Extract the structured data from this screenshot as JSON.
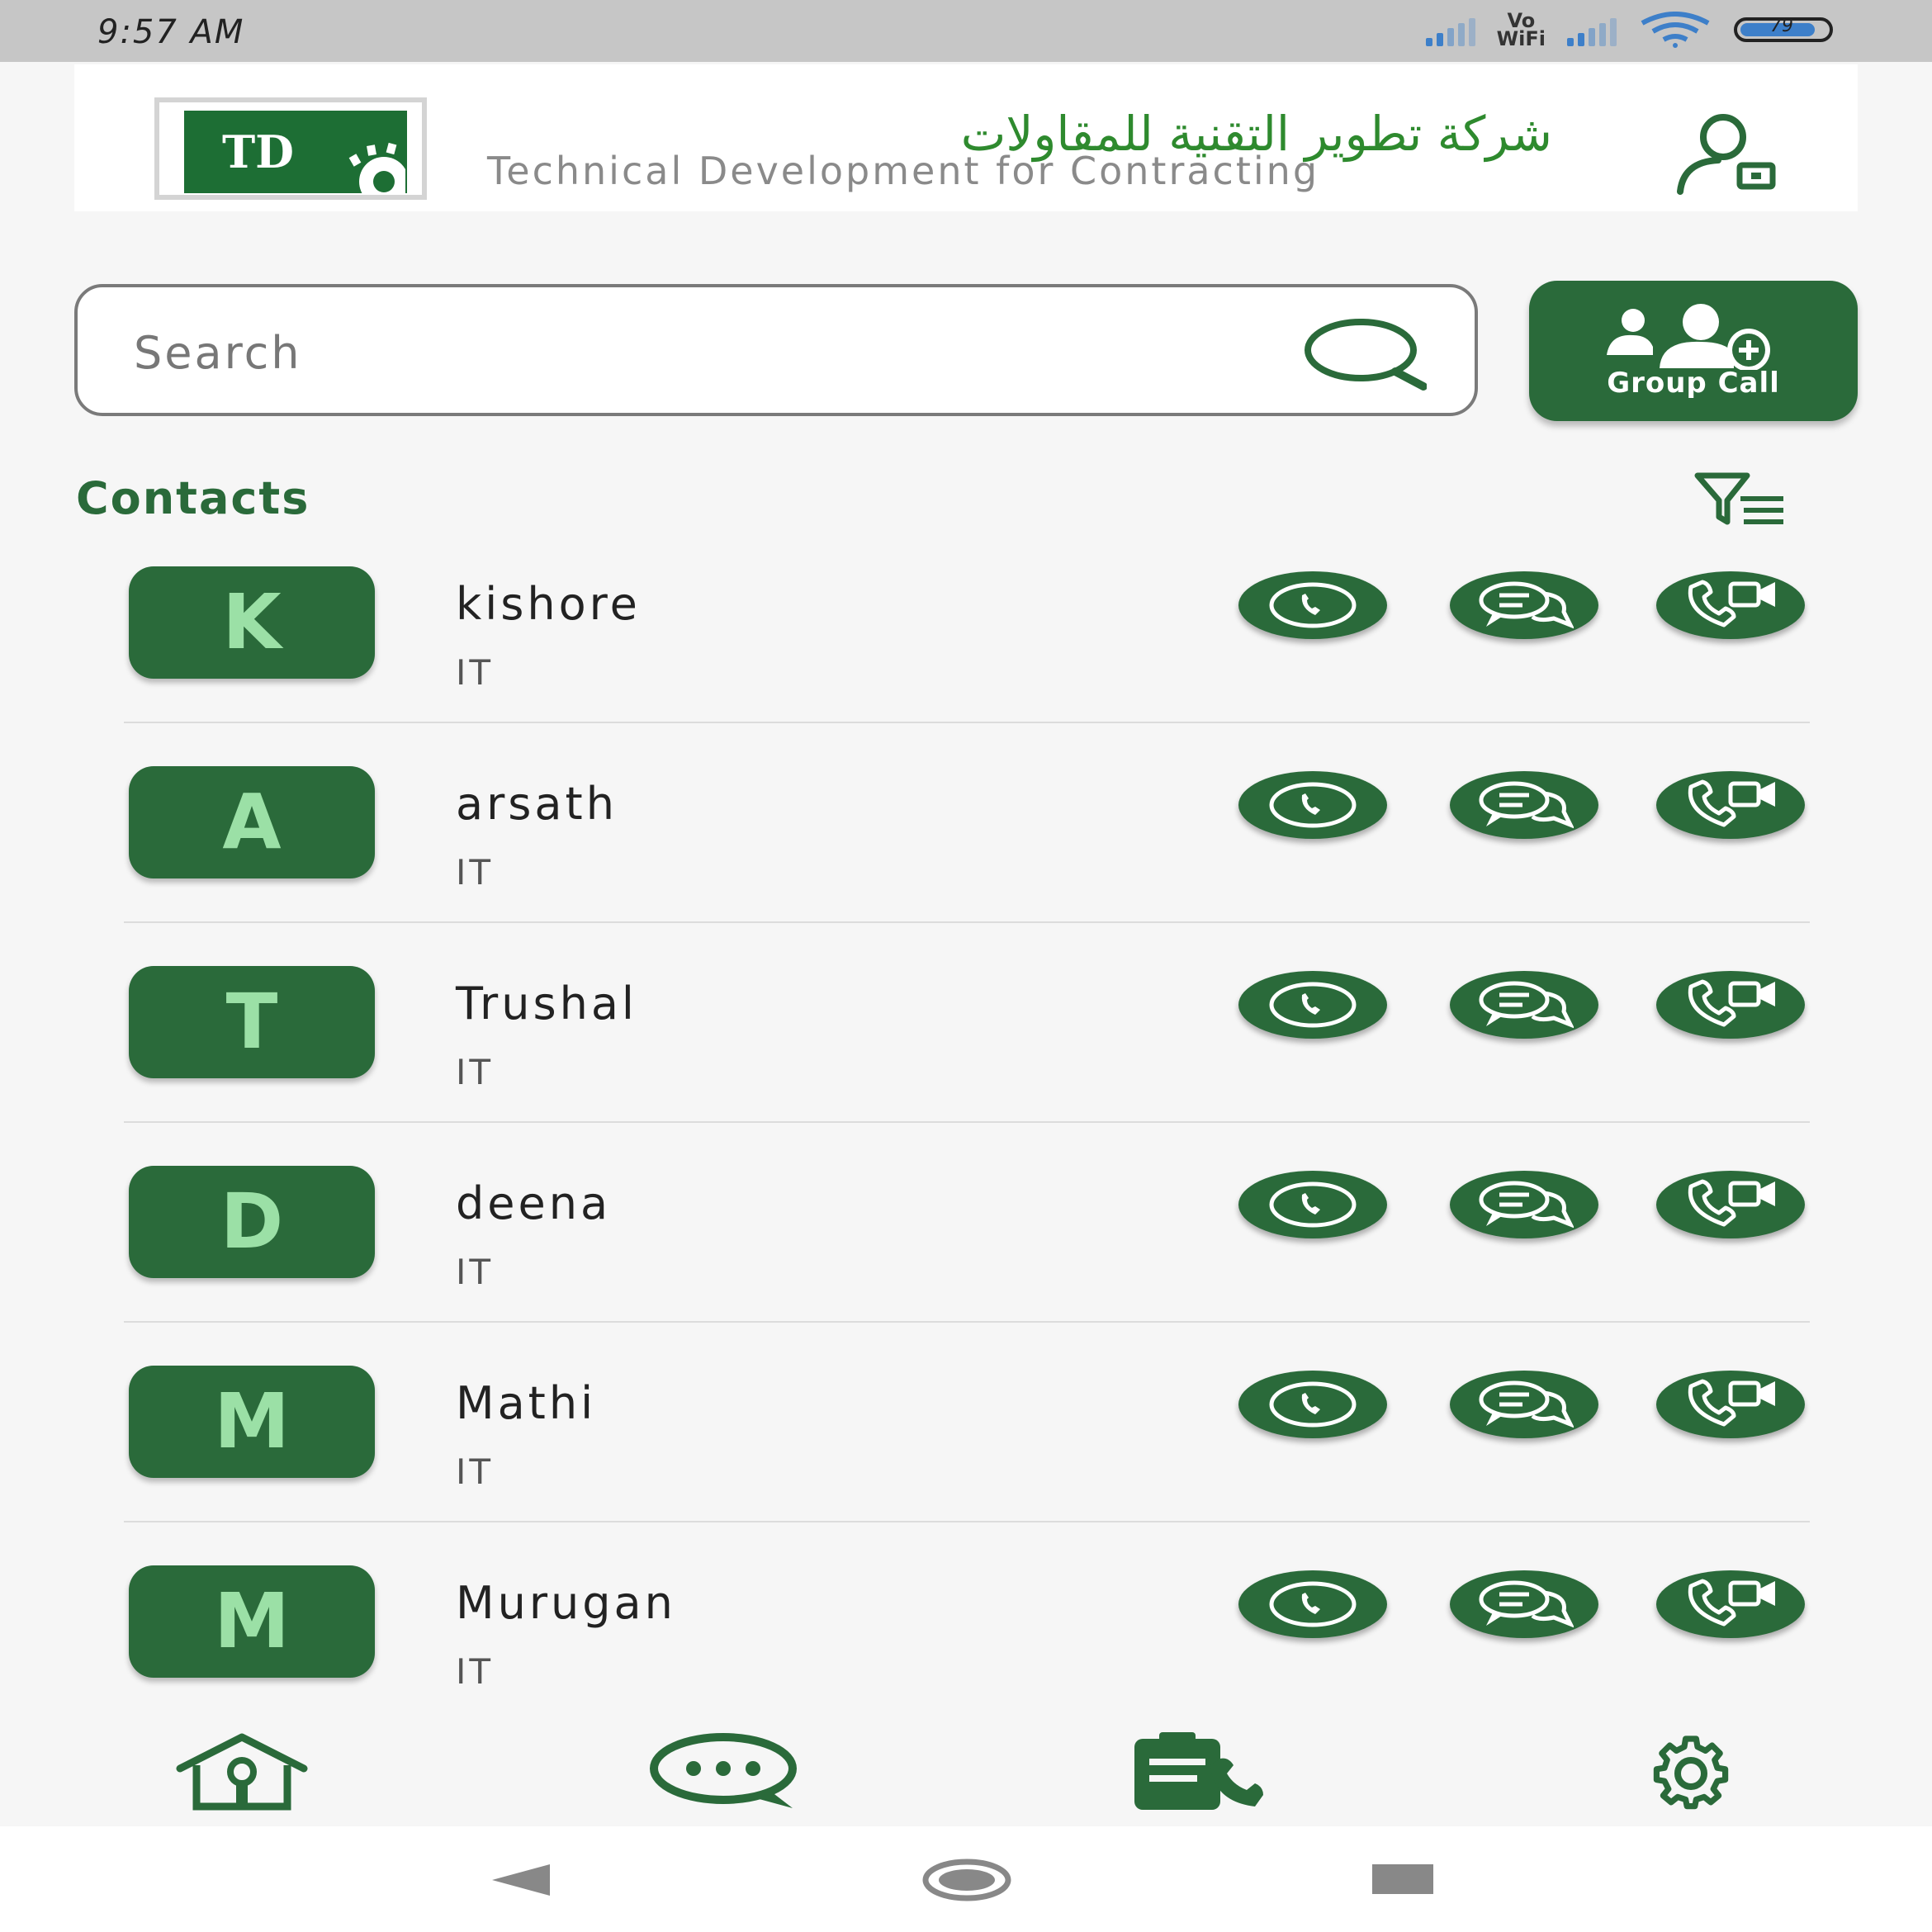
{
  "status_bar": {
    "time": "9:57 AM",
    "network_label_top": "Vo",
    "network_label_bottom": "WiFi",
    "battery": "79"
  },
  "header": {
    "logo_text": "TD",
    "brand_arabic": "شركة تطوير التقنية للمقاولات",
    "brand_english": "Technical Development for Contracting",
    "profile_icon": "user-badge-icon"
  },
  "search": {
    "placeholder": "Search",
    "value": ""
  },
  "group_call": {
    "label": "Group Call"
  },
  "contacts_section": {
    "title": "Contacts"
  },
  "contacts": [
    {
      "initial": "K",
      "name": "kishore",
      "department": "IT"
    },
    {
      "initial": "A",
      "name": "arsath",
      "department": "IT"
    },
    {
      "initial": "T",
      "name": "Trushal",
      "department": "IT"
    },
    {
      "initial": "D",
      "name": "deena",
      "department": "IT"
    },
    {
      "initial": "M",
      "name": "Mathi",
      "department": "IT"
    },
    {
      "initial": "M",
      "name": "Murugan",
      "department": "IT"
    }
  ],
  "colors": {
    "primary_green": "#2a6a3a",
    "avatar_letter": "#9be0a6",
    "background": "#f6f6f6"
  },
  "bottom_nav": [
    {
      "icon": "home-icon"
    },
    {
      "icon": "chat-bubble-icon"
    },
    {
      "icon": "call-log-icon"
    },
    {
      "icon": "settings-gear-icon"
    }
  ]
}
